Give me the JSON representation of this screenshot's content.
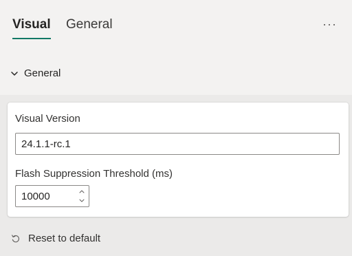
{
  "tabs": [
    {
      "label": "Visual",
      "active": true
    },
    {
      "label": "General",
      "active": false
    }
  ],
  "more_icon": "more-horizontal-icon",
  "section": {
    "title": "General",
    "icon": "chevron-down-icon"
  },
  "fields": {
    "version_label": "Visual Version",
    "version_value": "24.1.1-rc.1",
    "threshold_label": "Flash Suppression Threshold (ms)",
    "threshold_value": "10000"
  },
  "reset": {
    "label": "Reset to default",
    "icon": "reset-icon"
  },
  "colors": {
    "accent": "#117865",
    "background": "#f3f2f1",
    "card": "#ffffff",
    "border": "#8a8886"
  }
}
